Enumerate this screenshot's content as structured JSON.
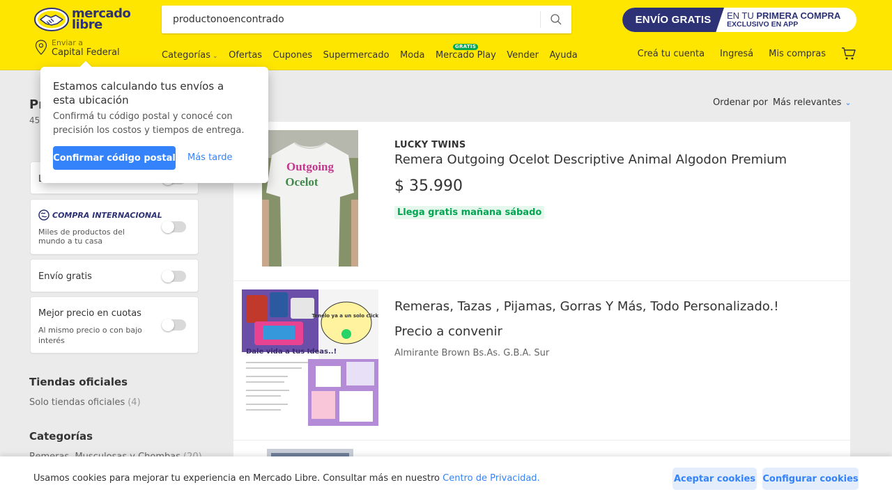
{
  "header": {
    "logo_text_1": "mercado",
    "logo_text_2": "libre",
    "search": {
      "value": "productonoencontrado",
      "placeholder": ""
    },
    "promo": {
      "badge": "ENVÍO GRATIS",
      "line1_prefix": "EN TU ",
      "line1_strong": "PRIMERA COMPRA",
      "line2": "EXCLUSIVO EN APP"
    },
    "location": {
      "small": "Enviar a",
      "city": "Capital Federal"
    },
    "nav": [
      {
        "label": "Categorías"
      },
      {
        "label": "Ofertas"
      },
      {
        "label": "Cupones"
      },
      {
        "label": "Supermercado"
      },
      {
        "label": "Moda"
      },
      {
        "label": "Mercado Play",
        "badge": "GRATIS"
      },
      {
        "label": "Vender"
      },
      {
        "label": "Ayuda"
      }
    ],
    "user_nav": {
      "signup": "Creá tu cuenta",
      "login": "Ingresá",
      "purchases": "Mis compras"
    }
  },
  "page": {
    "title_visible": "Pr",
    "count_visible": "45"
  },
  "sort": {
    "label": "Ordenar por",
    "value": "Más relevantes"
  },
  "filters": {
    "partial_label": "L",
    "compra_internacional": {
      "title": "COMPRA INTERNACIONAL",
      "sub": "Miles de productos del mundo a tu casa"
    },
    "envio_gratis": {
      "label": "Envío gratis"
    },
    "mejor_precio": {
      "label": "Mejor precio en cuotas",
      "sub": "Al mismo precio o con bajo interés"
    }
  },
  "sidebar": {
    "tiendas_heading": "Tiendas oficiales",
    "tiendas_link": "Solo tiendas oficiales",
    "tiendas_count": "(4)",
    "categorias_heading": "Categorías",
    "cat_link": "Remeras, Musculosas y Chombas",
    "cat_count": "(20)"
  },
  "results": [
    {
      "brand": "LUCKY TWINS",
      "title": "Remera Outgoing Ocelot Descriptive Animal Algodon Premium",
      "price": "$ 35.990",
      "shipping": "Llega gratis mañana sábado",
      "shirt_text_1": "Outgoing",
      "shirt_text_2": "Ocelot"
    },
    {
      "title": "Remeras, Tazas , Pijamas, Gorras Y Más, Todo Personalizado.!",
      "price": "Precio a convenir",
      "location": "Almirante Brown Bs.As. G.B.A. Sur",
      "promo_text": "Dale vida a tus Ideas..!",
      "bubble_text": "Tenelo ya a un solo click!"
    }
  ],
  "popover": {
    "title": "Estamos calculando tus envíos a esta ubicación",
    "body": "Confirmá tu código postal y conocé con precisión los costos y tiempos de entrega.",
    "confirm": "Confirmar código postal",
    "later": "Más tarde"
  },
  "cookie": {
    "text": "Usamos cookies para mejorar tu experiencia en Mercado Libre. Consultar más en nuestro ",
    "link": "Centro de Privacidad.",
    "accept": "Aceptar cookies",
    "configure": "Configurar cookies"
  },
  "colors": {
    "brand_yellow": "#ffe600",
    "brand_blue": "#3483fa",
    "logo_navy": "#2d3277",
    "green": "#00a650"
  }
}
